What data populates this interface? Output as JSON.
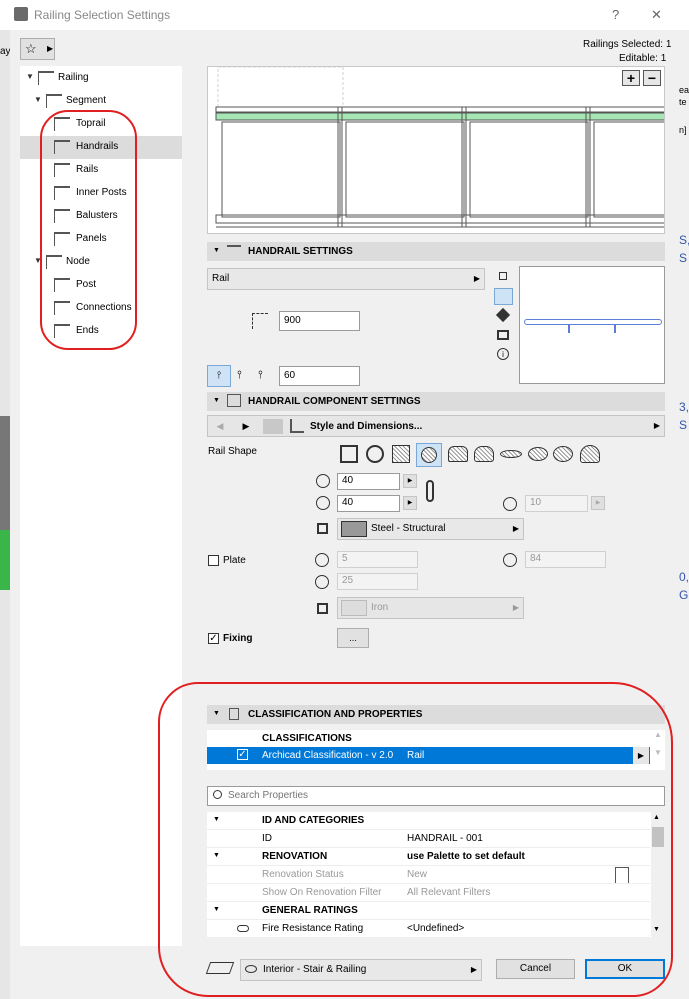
{
  "window": {
    "title": "Railing Selection Settings",
    "help": "?",
    "close": "✕"
  },
  "info": {
    "railings_selected": "Railings Selected: 1",
    "editable": "Editable: 1"
  },
  "tree": [
    {
      "label": "Railing",
      "level": 0,
      "arrow": true
    },
    {
      "label": "Segment",
      "level": 1,
      "arrow": true
    },
    {
      "label": "Toprail",
      "level": 2
    },
    {
      "label": "Handrails",
      "level": 2,
      "selected": true
    },
    {
      "label": "Rails",
      "level": 2
    },
    {
      "label": "Inner Posts",
      "level": 2
    },
    {
      "label": "Balusters",
      "level": 2
    },
    {
      "label": "Panels",
      "level": 2
    },
    {
      "label": "Node",
      "level": 1,
      "arrow": true
    },
    {
      "label": "Post",
      "level": 2
    },
    {
      "label": "Connections",
      "level": 2
    },
    {
      "label": "Ends",
      "level": 2
    }
  ],
  "preview": {
    "zoom_in": "+",
    "zoom_out": "−"
  },
  "handrail_settings": {
    "header": "HANDRAIL SETTINGS",
    "type": "Rail",
    "height": "900",
    "offset": "60"
  },
  "component_settings": {
    "header": "HANDRAIL COMPONENT SETTINGS",
    "page": "Style and Dimensions...",
    "rail_shape_label": "Rail Shape",
    "width": "40",
    "depth": "40",
    "radius": "10",
    "material": "Steel - Structural",
    "plate_label": "Plate",
    "plate_thickness": "5",
    "plate_width": "84",
    "plate_height": "25",
    "plate_material": "Iron",
    "fixing_label": "Fixing",
    "fixing_button": "..."
  },
  "classification": {
    "header": "CLASSIFICATION AND PROPERTIES",
    "classifications_label": "CLASSIFICATIONS",
    "system": "Archicad Classification - v 2.0",
    "value": "Rail",
    "search_placeholder": "Search Properties",
    "rows": [
      {
        "kind": "group",
        "c1": "ID AND CATEGORIES",
        "c2": ""
      },
      {
        "kind": "item",
        "c1": "ID",
        "c2": "HANDRAIL - 001"
      },
      {
        "kind": "group",
        "c1": "RENOVATION",
        "c2": "use Palette to set default"
      },
      {
        "kind": "grey",
        "c1": "Renovation Status",
        "c2": "New"
      },
      {
        "kind": "grey",
        "c1": "Show On Renovation Filter",
        "c2": "All Relevant Filters"
      },
      {
        "kind": "group",
        "c1": "GENERAL RATINGS",
        "c2": ""
      },
      {
        "kind": "item",
        "c1": "Fire Resistance Rating",
        "c2": "<Undefined>"
      }
    ]
  },
  "footer": {
    "layer": "Interior - Stair & Railing",
    "cancel": "Cancel",
    "ok": "OK"
  },
  "background_fragments": [
    "ay",
    "ea",
    "te",
    "n]",
    "S,",
    "S",
    "3,",
    "S",
    "0,",
    "G"
  ],
  "colors": {
    "accent": "#0078d7",
    "annotation": "#e02020",
    "preview_green": "#a6e6b4"
  }
}
